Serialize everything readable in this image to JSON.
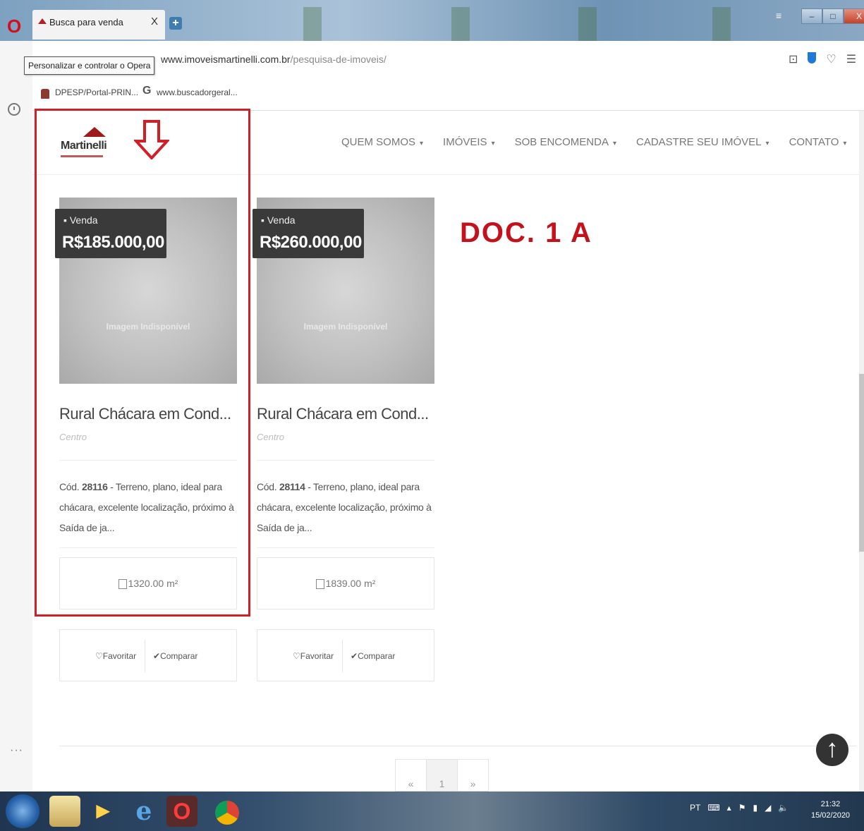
{
  "browser": {
    "tab_title": "Busca para venda",
    "tab_close": "X",
    "new_tab": "+",
    "tooltip": "Personalizar e controlar o Opera",
    "url_domain": "www.imoveismartinelli.com.br",
    "url_path": "/pesquisa-de-imoveis/",
    "bookmarks": [
      {
        "label": "DPESP/Portal-PRIN..."
      },
      {
        "label": "www.buscadorgeral..."
      }
    ],
    "window_controls": [
      "–",
      "□",
      "X"
    ]
  },
  "site": {
    "logo_text": "Martinelli",
    "nav": [
      {
        "label": "QUEM SOMOS"
      },
      {
        "label": "IMÓVEIS"
      },
      {
        "label": "SOB ENCOMENDA"
      },
      {
        "label": "CADASTRE SEU IMÓVEL"
      },
      {
        "label": "CONTATO"
      }
    ],
    "annotation_label": "DOC. 1 A",
    "cards": [
      {
        "type": "Venda",
        "price": "R$185.000,00",
        "image_caption": "Imagem Indisponível",
        "title": "Rural Chácara em Cond...",
        "location": "Centro",
        "code_prefix": "Cód. ",
        "code": "28116",
        "desc": " - Terreno, plano, ideal para chácara, excelente localização, próximo à Saída de ja...",
        "area": "1320.00 m²",
        "favorite": "Favoritar",
        "compare": "Comparar"
      },
      {
        "type": "Venda",
        "price": "R$260.000,00",
        "image_caption": "Imagem Indisponível",
        "title": "Rural Chácara em Cond...",
        "location": "Centro",
        "code_prefix": "Cód. ",
        "code": "28114",
        "desc": " - Terreno, plano, ideal para chácara, excelente localização, próximo à Saída de ja...",
        "area": "1839.00 m²",
        "favorite": "Favoritar",
        "compare": "Comparar"
      }
    ],
    "pagination": [
      "«",
      "1",
      "»"
    ]
  },
  "taskbar": {
    "tray_lang": "PT",
    "clock_time": "21:32",
    "clock_date": "15/02/2020"
  },
  "colors": {
    "highlight_red": "#d11f28",
    "doc_label_red": "#c4121c",
    "logo_red": "#9e1b1b"
  }
}
